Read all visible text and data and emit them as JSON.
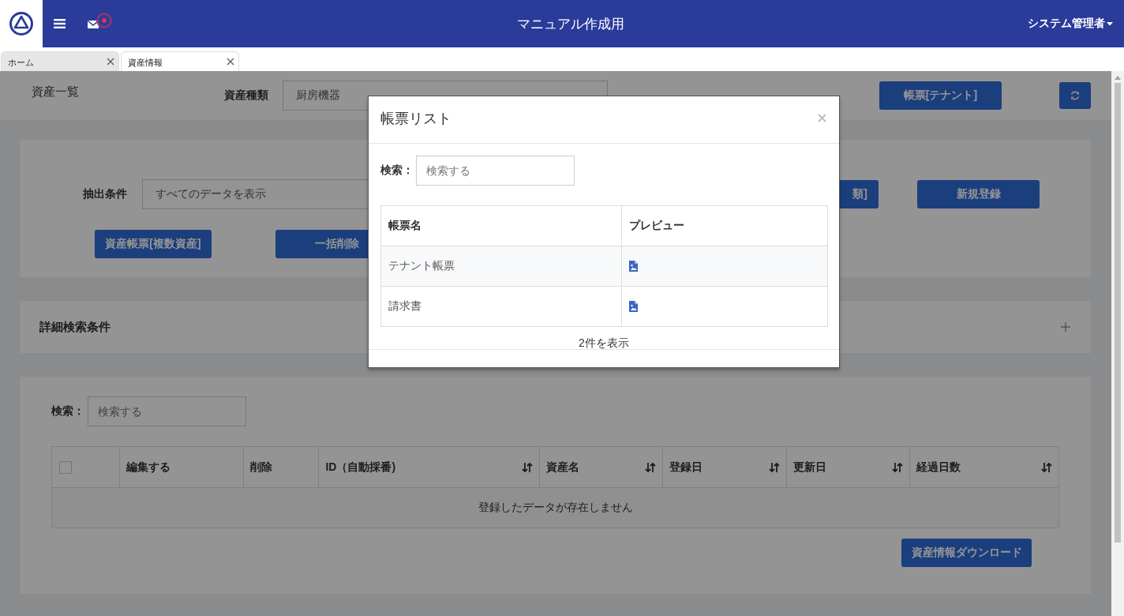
{
  "header": {
    "title": "マニュアル作成用",
    "user": "システム管理者",
    "has_notification": true
  },
  "tabs": [
    {
      "label": "ホーム",
      "selected": false
    },
    {
      "label": "資産情報",
      "selected": true
    }
  ],
  "page": {
    "title": "資産一覧",
    "asset_type": {
      "label": "資産種類",
      "value": "厨房機器"
    },
    "report_button": "帳票[テナント]"
  },
  "filter": {
    "label": "抽出条件",
    "value": "すべてのデータを表示",
    "buttons": [
      "類]",
      "新規登録"
    ],
    "action_buttons": [
      "資産帳票[複数資産]",
      "一括削除"
    ]
  },
  "advanced_search": {
    "title": "詳細検索条件",
    "expanded": false
  },
  "list": {
    "search": {
      "label": "検索：",
      "placeholder": "検索する"
    },
    "select_all": {
      "checked": false
    },
    "columns": [
      {
        "label": "編集する",
        "sortable": false
      },
      {
        "label": "削除",
        "sortable": false
      },
      {
        "label": "ID（自動採番)",
        "sortable": true
      },
      {
        "label": "資産名",
        "sortable": true
      },
      {
        "label": "登録日",
        "sortable": true
      },
      {
        "label": "更新日",
        "sortable": true
      },
      {
        "label": "経過日数",
        "sortable": true
      }
    ],
    "empty_message": "登録したデータが存在しません",
    "download_button": "資産情報ダウンロード"
  },
  "modal": {
    "title": "帳票リスト",
    "search": {
      "label": "検索：",
      "placeholder": "検索する"
    },
    "columns": [
      "帳票名",
      "プレビュー"
    ],
    "rows": [
      {
        "name": "テナント帳票"
      },
      {
        "name": "請求書"
      }
    ],
    "footer": "2件を表示"
  }
}
